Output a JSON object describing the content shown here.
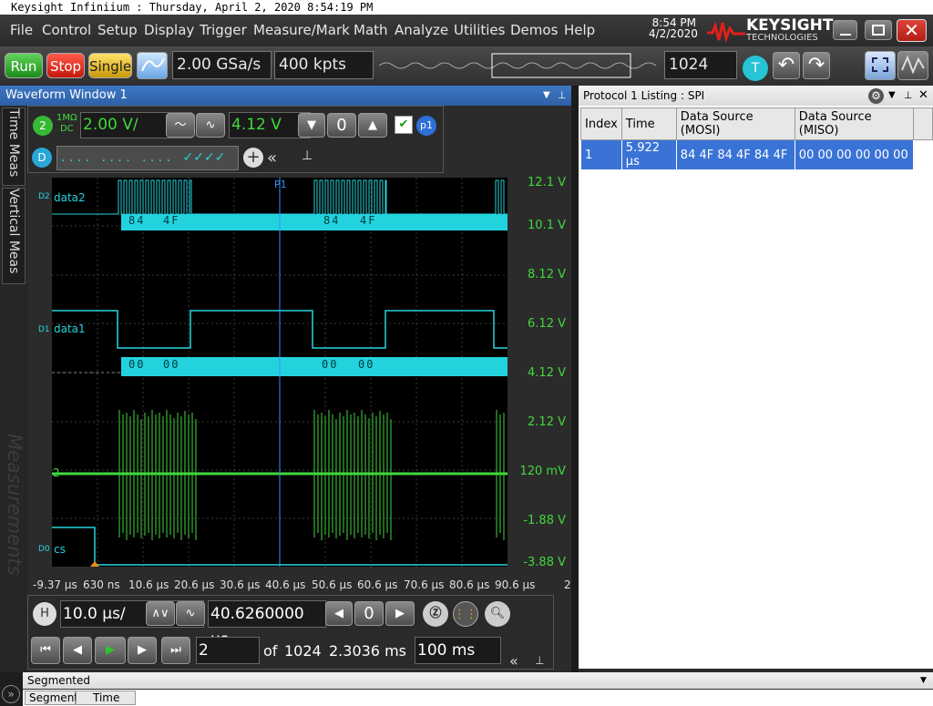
{
  "window": {
    "title": "Keysight Infiniium : Thursday, April 2, 2020 8:54:19 PM"
  },
  "menu": [
    "File",
    "Control",
    "Setup",
    "Display",
    "Trigger",
    "Measure/Mark",
    "Math",
    "Analyze",
    "Utilities",
    "Demos",
    "Help"
  ],
  "clock": {
    "time": "8:54 PM",
    "date": "4/2/2020"
  },
  "brand": {
    "name": "KEYSIGHT",
    "sub": "TECHNOLOGIES"
  },
  "toolbar": {
    "run": "Run",
    "stop": "Stop",
    "single": "Single",
    "sample_rate": "2.00 GSa/s",
    "memory_depth": "400 kpts",
    "segments": "1024",
    "trigger_badge": "T"
  },
  "waveform_window": {
    "title": "Waveform Window 1"
  },
  "side_tabs": [
    "Time Meas",
    "Vertical Meas"
  ],
  "watermark": "Measurements",
  "channel": {
    "number": "2",
    "coupling_top": "1MΩ",
    "coupling_bottom": "DC",
    "scale": "2.00 V/",
    "offset": "4.12 V",
    "protocol_badge": "p1",
    "digital_badge": "D",
    "digital_pattern": ". . . .   . . . .   . . . .   ✓✓✓✓"
  },
  "traces": {
    "d2_tag": "D2",
    "d2_name": "data2",
    "d2_bus": [
      "84",
      "4F",
      "84",
      "4F"
    ],
    "d1_tag": "D1",
    "d1_name": "data1",
    "d1_bus": [
      "00",
      "00",
      "00",
      "00"
    ],
    "d0_tag": "D0",
    "d0_name": "cs",
    "ch2_tag": "2",
    "marker": "P1"
  },
  "y_ticks": [
    "12.1 V",
    "10.1 V",
    "8.12 V",
    "6.12 V",
    "4.12 V",
    "2.12 V",
    "120 mV",
    "-1.88 V",
    "-3.88 V"
  ],
  "x_ticks": [
    "-9.37 µs",
    "630 ns",
    "10.6 µs",
    "20.6 µs",
    "30.6 µs",
    "40.6 µs",
    "50.6 µs",
    "60.6 µs",
    "70.6 µs",
    "80.6 µs",
    "90.6 µs"
  ],
  "x_tick_edge": "2",
  "horizontal": {
    "badge": "H",
    "scale": "10.0 µs/",
    "position": "40.6260000 µs",
    "segment": "2",
    "of_label": "of",
    "total_segments": "1024",
    "segment_time": "2.3036 ms",
    "playback": "100 ms"
  },
  "protocol": {
    "title": "Protocol 1 Listing : SPI",
    "columns": [
      "Index",
      "Time",
      "Data Source (MOSI)",
      "Data Source (MISO)"
    ],
    "rows": [
      [
        "1",
        "5.922 µs",
        "84 4F 84 4F 84 4F",
        "00 00 00 00 00 00"
      ]
    ]
  },
  "segmented_panel": {
    "title": "Segmented",
    "columns": [
      "Segment",
      "Time"
    ]
  }
}
